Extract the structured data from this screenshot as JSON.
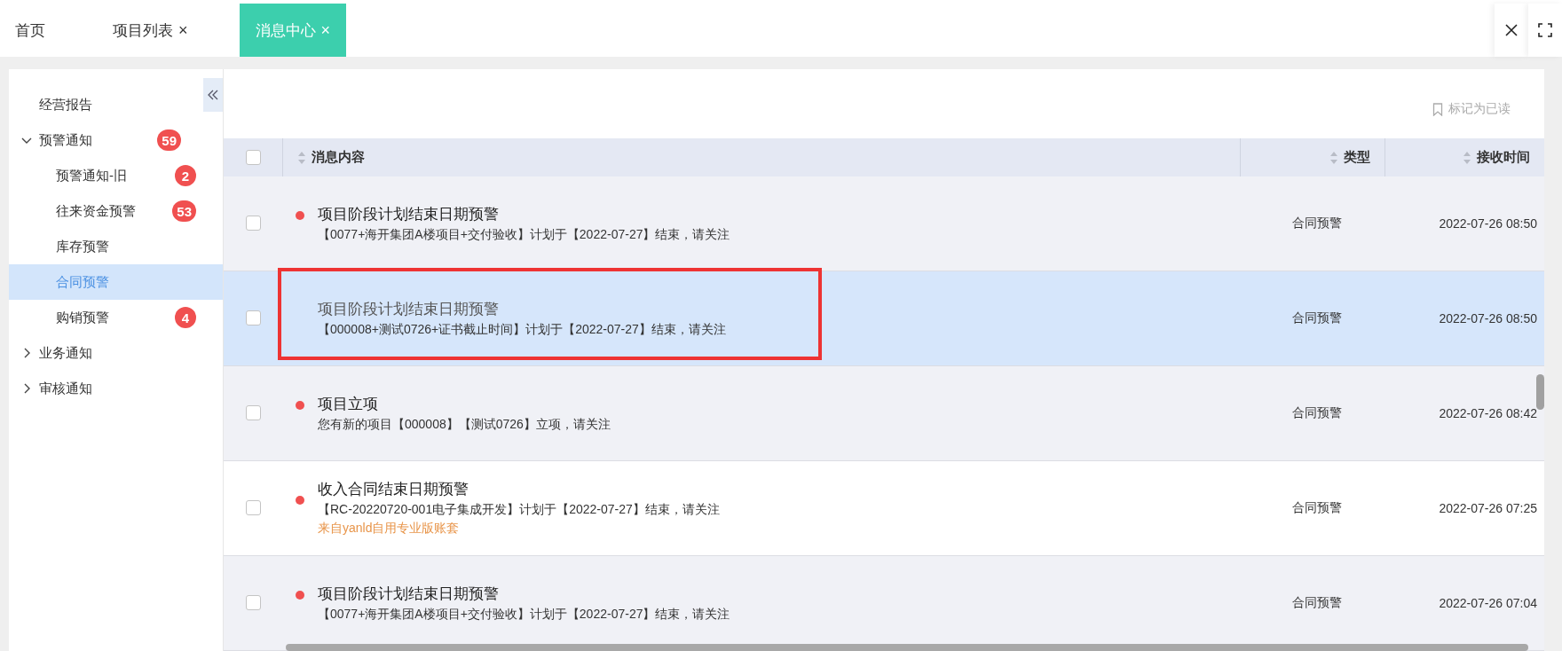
{
  "tabs": [
    {
      "label": "首页",
      "selected": false
    },
    {
      "label": "项目列表",
      "close": "×",
      "selected": false
    },
    {
      "label": "消息中心",
      "close": "×",
      "selected": true
    }
  ],
  "sidebar": {
    "items": [
      {
        "label": "经营报告",
        "selected": false
      },
      {
        "label": "预警通知",
        "expanded": true,
        "badge": "59",
        "children": [
          {
            "label": "预警通知-旧",
            "badge": "2",
            "selected": false
          },
          {
            "label": "往来资金预警",
            "badge": "53",
            "selected": false
          },
          {
            "label": "库存预警",
            "selected": false
          },
          {
            "label": "合同预警",
            "selected": true
          },
          {
            "label": "购销预警",
            "badge": "4",
            "selected": false
          }
        ]
      },
      {
        "label": "业务通知",
        "expanded": false
      },
      {
        "label": "审核通知",
        "expanded": false
      }
    ]
  },
  "mark_read": {
    "label": "标记为已读"
  },
  "table": {
    "columns": [
      {
        "label": "消息内容"
      },
      {
        "label": "类型"
      },
      {
        "label": "接收时间"
      }
    ],
    "all_checked": false,
    "rows": [
      {
        "title": "项目阶段计划结束日期预警",
        "detail": "【0077+海开集团A楼项目+交付验收】计划于【2022-07-27】结束，请关注",
        "type": "合同预警",
        "time": "2022-07-26 08:50",
        "unread": true,
        "selected": false,
        "checked": false,
        "striped": true,
        "highlighted": false
      },
      {
        "title": "项目阶段计划结束日期预警",
        "detail": "【000008+测试0726+证书截止时间】计划于【2022-07-27】结束，请关注",
        "type": "合同预警",
        "time": "2022-07-26 08:50",
        "unread": false,
        "selected": true,
        "checked": false,
        "highlighted": true
      },
      {
        "title": "项目立项",
        "detail": "您有新的项目【000008】【测试0726】立项，请关注",
        "type": "合同预警",
        "time": "2022-07-26 08:42",
        "unread": true,
        "selected": false,
        "checked": false,
        "striped": true,
        "highlighted": false
      },
      {
        "title": "收入合同结束日期预警",
        "detail": "【RC-20220720-001电子集成开发】计划于【2022-07-27】结束，请关注",
        "source": "来自yanld自用专业版账套",
        "type": "合同预警",
        "time": "2022-07-26 07:25",
        "unread": true,
        "selected": false,
        "checked": false,
        "striped": false,
        "highlighted": false
      },
      {
        "title": "项目阶段计划结束日期预警",
        "detail": "【0077+海开集团A楼项目+交付验收】计划于【2022-07-27】结束，请关注",
        "type": "合同预警",
        "time": "2022-07-26 07:04",
        "unread": true,
        "selected": false,
        "checked": false,
        "striped": true,
        "highlighted": false
      }
    ]
  }
}
